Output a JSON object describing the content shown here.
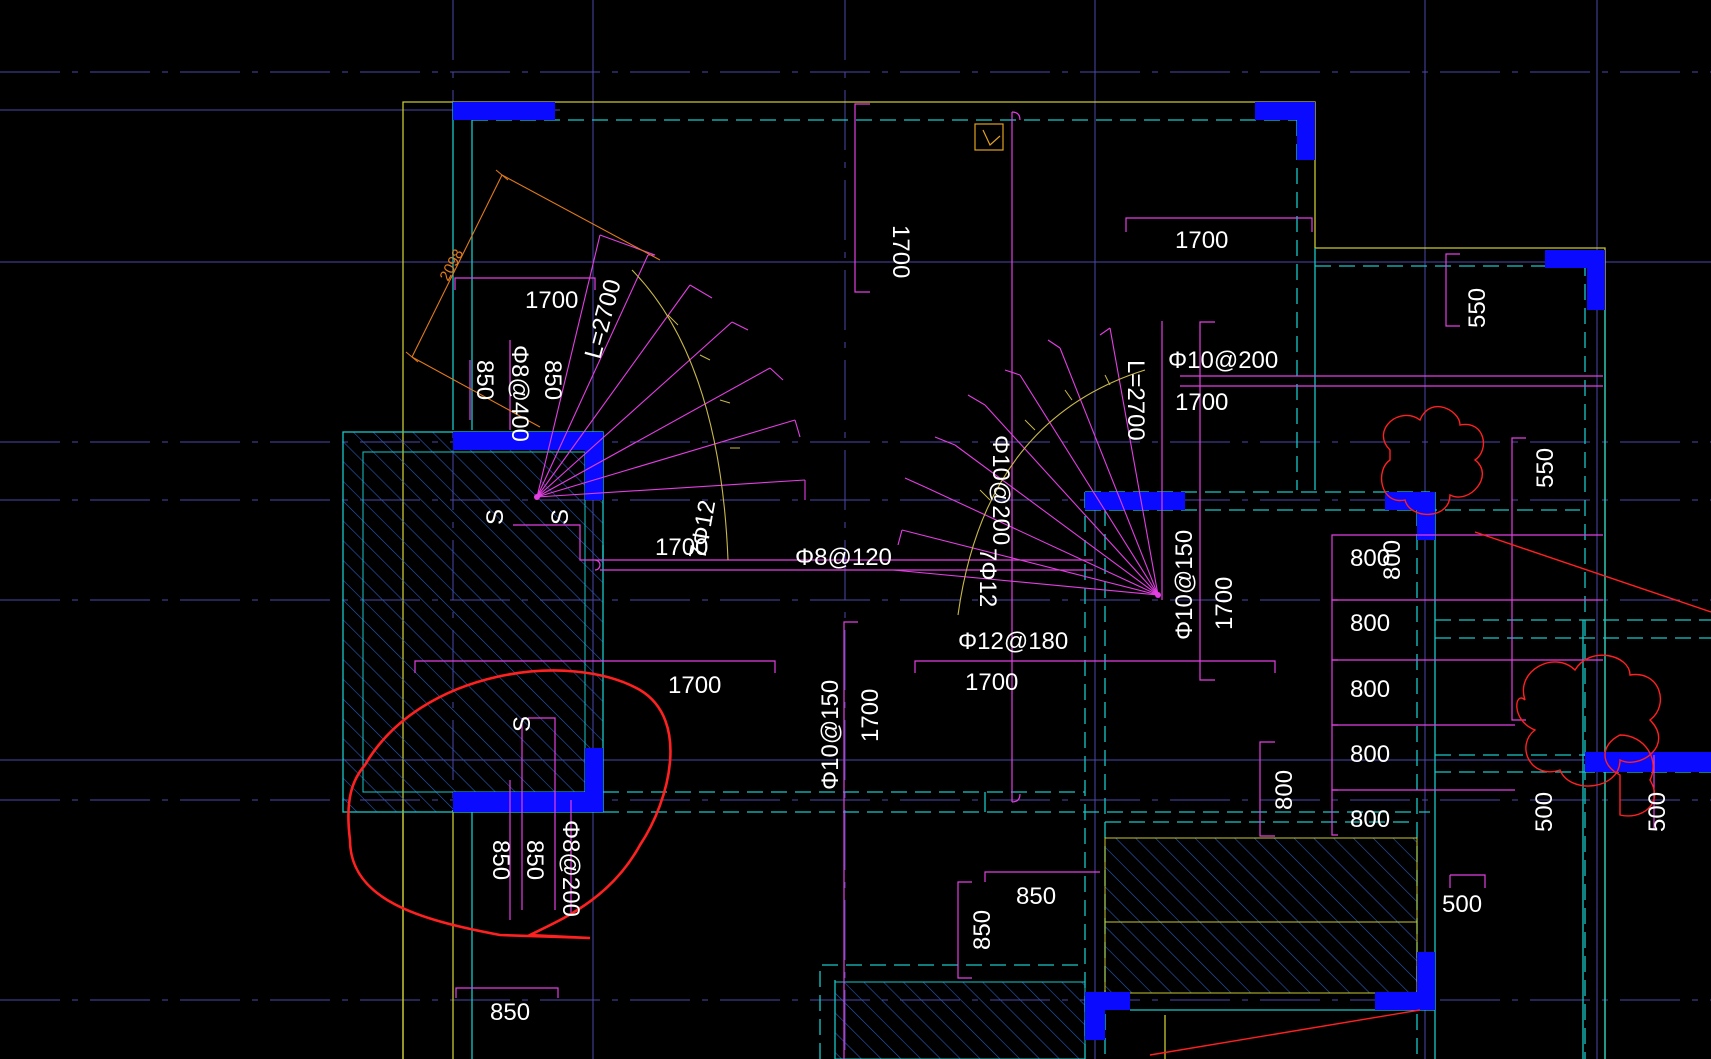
{
  "drawing": {
    "colors": {
      "background": "#000000",
      "grid": "#6b55c8",
      "gridDashed": "#4a4ab0",
      "wallCyan": "#19c7c7",
      "wallYellow": "#c8c832",
      "column": "#0a0aff",
      "rebarMagenta": "#e23fe2",
      "hatch": "#2a5bb8",
      "orange": "#e07a1a",
      "markup": "#ff2020",
      "text": "#ffffff"
    },
    "labels": {
      "top_1700_a": "1700",
      "top_1700_b": "1700",
      "top_1700_c": "1700",
      "left_1700": "1700",
      "L2700_left": "L=2700",
      "L2700_right": "L=2700",
      "dim_2098": "2098",
      "bar_8at400": "Φ8@400",
      "dim_850_a": "850",
      "dim_850_b": "850",
      "s_a": "S",
      "s_b": "S",
      "s_c": "S",
      "bar_7phi12_left": "7Φ12",
      "mid_1700_a": "1700",
      "bar_8at120": "Φ8@120",
      "bar_10at200_mid": "Φ10@200",
      "bar_7phi12_right": "7Φ12",
      "bar_10at200_right": "Φ10@200",
      "right_1700": "1700",
      "bar_12at180": "Φ12@180",
      "low_1700_a": "1700",
      "low_1700_b": "1700",
      "bar_10at150_a": "Φ10@150",
      "v_1700_a": "1700",
      "bar_10at150_b": "Φ10@150",
      "v_1700_b": "1700",
      "dim_550_a": "550",
      "dim_550_b": "550",
      "dim_800_1": "800",
      "dim_800_1b": "800",
      "dim_800_2": "800",
      "dim_800_3": "800",
      "dim_800_4": "800",
      "dim_800_5": "800",
      "dim_800_v": "800",
      "dim_500_a": "500",
      "dim_500_b": "500",
      "dim_500_c": "500",
      "bottom_850_a": "850",
      "bottom_850_b": "850",
      "bottom_bar_8at200": "Φ8@200",
      "mid_850_h": "850",
      "mid_850_v": "850",
      "bottom_850_c": "850"
    }
  }
}
